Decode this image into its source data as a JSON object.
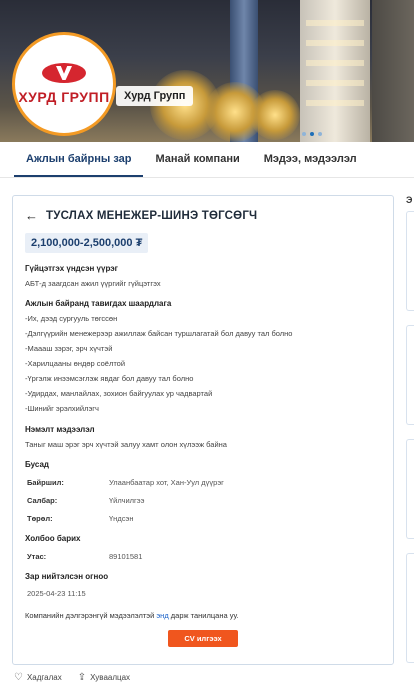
{
  "company": {
    "name": "Хурд Групп",
    "logo_text": "ХУРД ГРУПП"
  },
  "tabs": [
    {
      "label": "Ажлын байрны зар",
      "active": true
    },
    {
      "label": "Манай компани",
      "active": false
    },
    {
      "label": "Мэдээ, мэдээлэл",
      "active": false
    }
  ],
  "job": {
    "title": "ТУСЛАХ МЕНЕЖЕР-ШИНЭ ТӨГСӨГЧ",
    "salary": "2,100,000-2,500,000 ₮",
    "main_duty_heading": "Гүйцэтгэх үндсэн үүрэг",
    "main_duty_text": "АБТ-д заагдсан ажил үүргийг гүйцэтгэх",
    "requirements_heading": "Ажлын байранд тавигдах шаардлага",
    "requirements": [
      "-Их, дээд сургууль төгссөн",
      "-Дэлгүүрийн менежерээр ажиллаж байсан туршлагатай бол давуу тал болно",
      "-Маааш зэрэг, эрч хүчтэй",
      "-Харилцааны өндөр соёлтой",
      "-Үргэлж инээмсэглэж явдаг бол давуу тал болно",
      "-Удирдах, манлайлах, зохион байгуулах ур чадвартай",
      "-Шинийг эрэлхийлэгч"
    ],
    "extra_heading": "Нэмэлт мэдээлэл",
    "extra_text": "Таныг маш эрэг эрч хүчтэй залуу хамт олон хүлээж байна",
    "other_heading": "Бусад",
    "other": [
      {
        "key": "Байршил:",
        "value": "Улаанбаатар хот, Хан-Уул дүүрэг"
      },
      {
        "key": "Салбар:",
        "value": "Үйлчилгээ"
      },
      {
        "key": "Төрөл:",
        "value": "Үндсэн"
      }
    ],
    "contact_heading": "Холбоо барих",
    "contact": {
      "key": "Утас:",
      "value": "89101581"
    },
    "posted_heading": "Зар нийтэлсэн огноо",
    "posted_date": "2025-04-23 11:15",
    "note_prefix": "Компанийн дэлгэрэнгүй мэдээлэлтэй ",
    "note_link": "энд",
    "note_suffix": " дарж танилцана уу.",
    "cv_button": "CV илгээх"
  },
  "footer": {
    "save_label": "Хадгалах",
    "share_label": "Хуваалцах"
  },
  "side": {
    "heading": "Э"
  },
  "colors": {
    "accent": "#1c3f6e",
    "cta": "#f0561e",
    "logo_red": "#d5262f",
    "logo_ring": "#f39a24"
  },
  "icons": {
    "back": "arrow-left-icon",
    "save": "heart-icon",
    "share": "share-icon"
  }
}
